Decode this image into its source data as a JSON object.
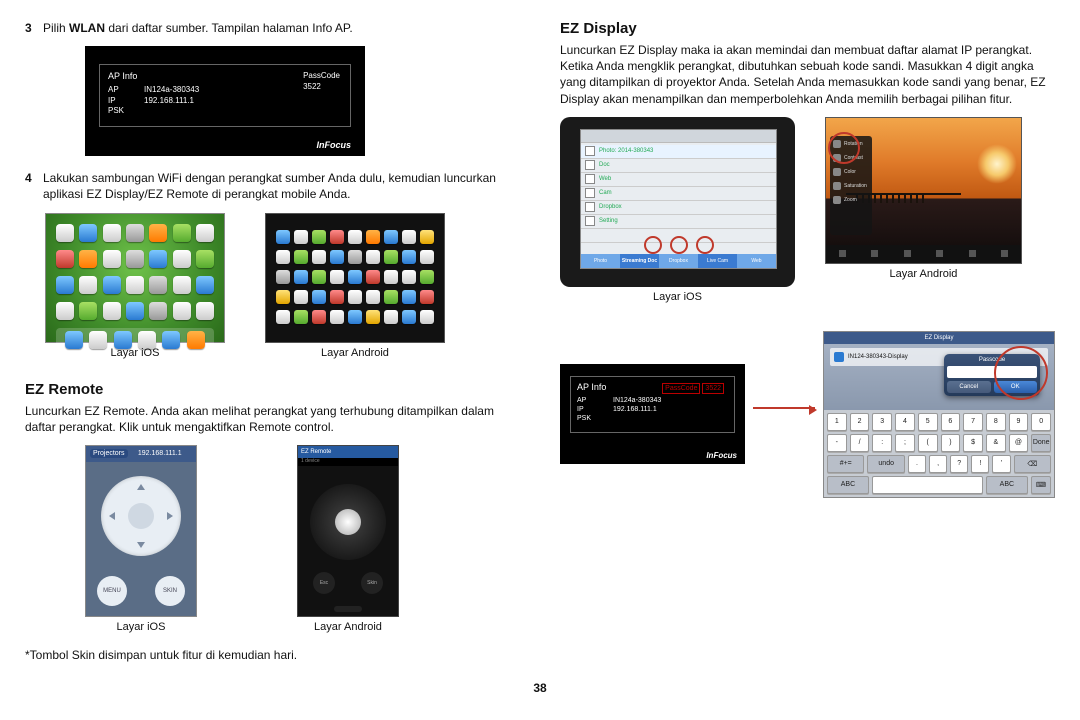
{
  "left": {
    "step3": {
      "num": "3",
      "pre": "Pilih ",
      "bold": "WLAN",
      "post": " dari daftar sumber. Tampilan halaman Info AP."
    },
    "ap": {
      "title": "AP Info",
      "labels": {
        "ap": "AP",
        "ip": "IP",
        "psk": "PSK"
      },
      "values": {
        "ap": "IN124a-380343",
        "ip": "192.168.111.1",
        "psk": ""
      },
      "pass_label": "PassCode",
      "pass_value": "3522",
      "logo": "InFocus"
    },
    "step4": {
      "num": "4",
      "text": "Lakukan sambungan WiFi dengan perangkat sumber Anda dulu, kemudian luncurkan aplikasi EZ Display/EZ Remote di perangkat mobile Anda."
    },
    "caption_ios": "Layar iOS",
    "caption_android": "Layar Android",
    "ezremote_heading": "EZ Remote",
    "ezremote_text": "Luncurkan EZ Remote. Anda akan melihat perangkat yang terhubung ditampilkan dalam daftar perangkat. Klik untuk mengaktifkan Remote control.",
    "remote_ios": {
      "back": "Projectors",
      "ip": "192.168.111.1",
      "menu": "MENU",
      "skin": "SKIN"
    },
    "remote_android": {
      "title": "EZ Remote",
      "sub": "1 device",
      "esc": "Esc",
      "skin": "Skin"
    },
    "footnote": "*Tombol Skin disimpan untuk fitur di kemudian hari."
  },
  "right": {
    "heading": "EZ Display",
    "intro": "Luncurkan EZ Display maka ia akan memindai dan membuat daftar alamat IP perangkat. Ketika Anda mengklik perangkat, dibutuhkan sebuah kode sandi. Masukkan 4 digit angka yang ditampilkan di proyektor Anda. Setelah Anda memasukkan kode sandi yang benar, EZ Display akan menampilkan dan memperbolehkan Anda memilih berbagai pilihan fitur.",
    "tabs": [
      "Photo",
      "Streaming Doc",
      "Dropbox",
      "Live Cam",
      "Web"
    ],
    "listItems": [
      "Photo: 2014-380343",
      "Doc",
      "Web",
      "Cam",
      "Dropbox",
      "Setting"
    ],
    "panel": [
      "Rotation",
      "Contrast",
      "Color",
      "Saturation",
      "Zoom"
    ],
    "caption_ios": "Layar iOS",
    "caption_android": "Layar Android",
    "modal": {
      "title": "Passcode",
      "cancel": "Cancel",
      "ok": "OK",
      "header": "EZ Display",
      "device": "IN124-380343-Display"
    },
    "keyboard": {
      "row1": [
        "1",
        "2",
        "3",
        "4",
        "5",
        "6",
        "7",
        "8",
        "9",
        "0"
      ],
      "row2": [
        "-",
        "/",
        ":",
        ";",
        "(",
        ")",
        "$",
        "&",
        "@",
        "Done"
      ],
      "row3": [
        "#+=",
        "undo",
        ".",
        ",",
        "?",
        "!",
        "'",
        "⌫"
      ],
      "row4": [
        "ABC",
        "",
        "ABC",
        "⌨"
      ]
    }
  },
  "pagenum": "38"
}
